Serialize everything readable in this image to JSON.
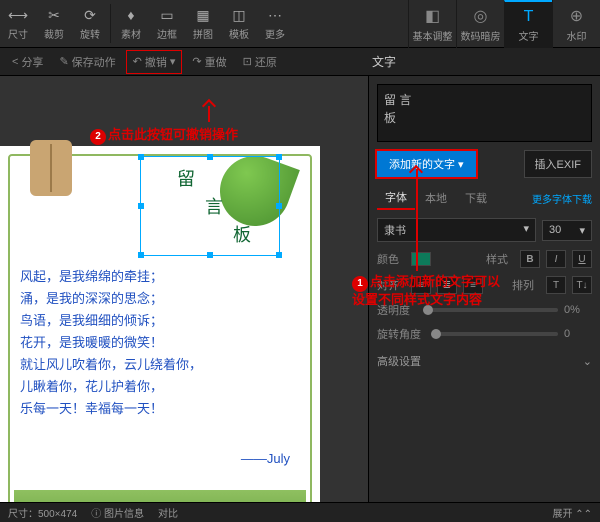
{
  "toolbar": {
    "size": "尺寸",
    "crop": "裁剪",
    "rotate": "旋转",
    "material": "素材",
    "border": "边框",
    "puzzle": "拼图",
    "template": "模板",
    "more": "更多"
  },
  "rightTabs": {
    "basic": "基本调整",
    "digital": "数码暗房",
    "text": "文字",
    "watermark": "水印"
  },
  "secondBar": {
    "share": "分享",
    "saveAction": "保存动作",
    "undo": "撤销",
    "redo": "重做",
    "restore": "还原"
  },
  "textBox": {
    "line1": "留",
    "line2": "言",
    "line3": "板"
  },
  "bodyLines": [
    "风起，是我绵绵的牵挂；",
    "涌，是我的深深的思念；",
    "鸟语，是我细细的倾诉；",
    "花开，是我暖暖的微笑！",
    "就让风儿吹着你，云儿绕着你，",
    "儿瞅着你，花儿护着你，",
    "乐每一天！幸福每一天！"
  ],
  "signature": "——July",
  "panel": {
    "title": "文字",
    "previewL1": "留    言",
    "previewL2": "板",
    "addNewText": "添加新的文字",
    "insertExif": "插入EXIF",
    "fontTab": "字体",
    "localTab": "本地",
    "downloadTab": "下载",
    "moreFonts": "更多字体下载",
    "fontName": "隶书",
    "fontSize": "30",
    "colorLbl": "颜色",
    "styleLbl": "样式",
    "alignLbl": "对齐",
    "arrangeLbl": "排列",
    "opacityLbl": "透明度",
    "opacityVal": "0%",
    "rotateLbl": "旋转角度",
    "rotateVal": "0",
    "advanced": "高级设置"
  },
  "annotations": {
    "a1": "点击添加新的文字可以\n设置不同样式文字内容",
    "a2": "点击此按钮可撤销操作"
  },
  "status": {
    "dims": "尺寸：500×474",
    "imageInfo": "图片信息",
    "compare": "对比",
    "expand": "展开"
  }
}
